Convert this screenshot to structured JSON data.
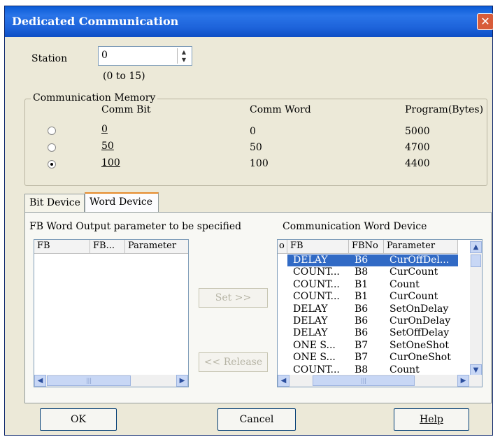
{
  "window": {
    "title": "Dedicated Communication",
    "close_glyph": "✕"
  },
  "station": {
    "label": "Station",
    "value": "0",
    "range_hint": "(0 to 15)"
  },
  "comm_memory": {
    "legend": "Communication Memory",
    "headers": {
      "bit": "Comm Bit",
      "word": "Comm Word",
      "program": "Program(Bytes)"
    },
    "options": [
      {
        "bit": "0",
        "word": "0",
        "program": "5000",
        "selected": false
      },
      {
        "bit": "50",
        "word": "50",
        "program": "4700",
        "selected": false
      },
      {
        "bit": "100",
        "word": "100",
        "program": "4400",
        "selected": true
      }
    ]
  },
  "tabs": [
    {
      "label": "Bit Device",
      "active": false
    },
    {
      "label": "Word Device",
      "active": true
    }
  ],
  "left_list": {
    "caption": "FB Word Output parameter to be specified",
    "columns": [
      "FB",
      "FB...",
      "Parameter"
    ]
  },
  "buttons": {
    "set": "Set >>",
    "release": "<< Release",
    "ok": "OK",
    "cancel": "Cancel",
    "help": "Help"
  },
  "right_list": {
    "caption": "Communication Word Device",
    "columns": [
      "o",
      "FB",
      "FBNo",
      "Parameter"
    ],
    "rows": [
      {
        "fb": "DELAY",
        "fbno": "B6",
        "param": "CurOffDel...",
        "selected": true
      },
      {
        "fb": "COUNT...",
        "fbno": "B8",
        "param": "CurCount"
      },
      {
        "fb": "COUNT...",
        "fbno": "B1",
        "param": "Count"
      },
      {
        "fb": "COUNT...",
        "fbno": "B1",
        "param": "CurCount"
      },
      {
        "fb": "DELAY",
        "fbno": "B6",
        "param": "SetOnDelay"
      },
      {
        "fb": "DELAY",
        "fbno": "B6",
        "param": "CurOnDelay"
      },
      {
        "fb": "DELAY",
        "fbno": "B6",
        "param": "SetOffDelay"
      },
      {
        "fb": "ONE S...",
        "fbno": "B7",
        "param": "SetOneShot"
      },
      {
        "fb": "ONE S...",
        "fbno": "B7",
        "param": "CurOneShot"
      },
      {
        "fb": "COUNT...",
        "fbno": "B8",
        "param": "Count"
      }
    ]
  },
  "icons": {
    "spin_up": "▲",
    "spin_down": "▼",
    "scroll_left": "◀",
    "scroll_right": "▶",
    "scroll_up": "▲",
    "scroll_down": "▼",
    "thumb_grip": "|||"
  },
  "colors": {
    "title_bar": "#1d63da",
    "selection": "#316ac5",
    "close_button": "#d85c3a"
  }
}
